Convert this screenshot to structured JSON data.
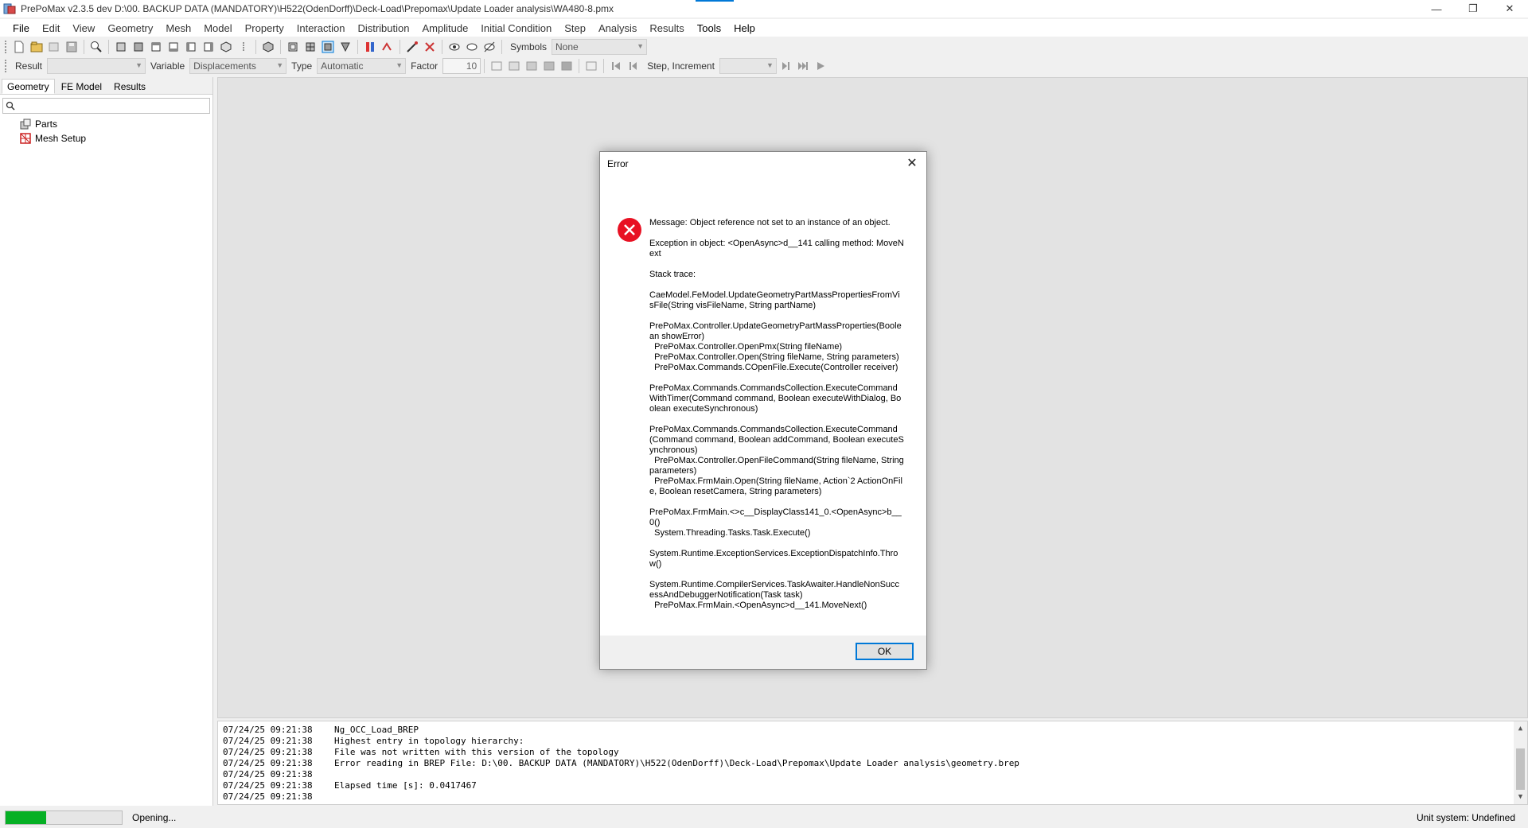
{
  "window": {
    "title": "PrePoMax v2.3.5 dev   D:\\00. BACKUP DATA (MANDATORY)\\H522(OdenDorff)\\Deck-Load\\Prepomax\\Update Loader analysis\\WA480-8.pmx"
  },
  "menu": [
    "File",
    "Edit",
    "View",
    "Geometry",
    "Mesh",
    "Model",
    "Property",
    "Interaction",
    "Distribution",
    "Amplitude",
    "Initial Condition",
    "Step",
    "Analysis",
    "Results",
    "Tools",
    "Help"
  ],
  "toolbar1": {
    "symbols_label": "Symbols",
    "symbols_value": "None"
  },
  "toolbar2": {
    "result_label": "Result",
    "result_value": "",
    "variable_label": "Variable",
    "variable_value": "Displacements",
    "type_label": "Type",
    "type_value": "Automatic",
    "factor_label": "Factor",
    "factor_value": "10",
    "step_label": "Step, Increment",
    "step_value": ""
  },
  "left_panel": {
    "tabs": [
      "Geometry",
      "FE Model",
      "Results"
    ],
    "tree": [
      "Parts",
      "Mesh Setup"
    ]
  },
  "log": [
    {
      "time": "07/24/25 09:21:38",
      "text": "Ng_OCC_Load_BREP"
    },
    {
      "time": "07/24/25 09:21:38",
      "text": "Highest entry in topology hierarchy:"
    },
    {
      "time": "07/24/25 09:21:38",
      "text": "File was not written with this version of the topology"
    },
    {
      "time": "07/24/25 09:21:38",
      "text": "Error reading in BREP File: D:\\00. BACKUP DATA (MANDATORY)\\H522(OdenDorff)\\Deck-Load\\Prepomax\\Update Loader analysis\\geometry.brep"
    },
    {
      "time": "07/24/25 09:21:38",
      "text": ""
    },
    {
      "time": "07/24/25 09:21:38",
      "text": "Elapsed time [s]: 0.0417467"
    },
    {
      "time": "07/24/25 09:21:38",
      "text": ""
    }
  ],
  "status": {
    "progress": 0.35,
    "text": "Opening...",
    "unit": "Unit system: Undefined"
  },
  "dialog": {
    "title": "Error",
    "paragraphs": [
      "Message: Object reference not set to an instance of an object.",
      "Exception in object: <OpenAsync>d__141 calling method: MoveNext",
      "Stack trace:",
      "CaeModel.FeModel.UpdateGeometryPartMassPropertiesFromVisFile(String visFileName, String partName)",
      "PrePoMax.Controller.UpdateGeometryPartMassProperties(Boolean showError)\n  PrePoMax.Controller.OpenPmx(String fileName)\n  PrePoMax.Controller.Open(String fileName, String parameters)\n  PrePoMax.Commands.COpenFile.Execute(Controller receiver)",
      "PrePoMax.Commands.CommandsCollection.ExecuteCommandWithTimer(Command command, Boolean executeWithDialog, Boolean executeSynchronous)",
      "PrePoMax.Commands.CommandsCollection.ExecuteCommand(Command command, Boolean addCommand, Boolean executeSynchronous)\n  PrePoMax.Controller.OpenFileCommand(String fileName, String parameters)\n  PrePoMax.FrmMain.Open(String fileName, Action`2 ActionOnFile, Boolean resetCamera, String parameters)",
      "PrePoMax.FrmMain.<>c__DisplayClass141_0.<OpenAsync>b__0()\n  System.Threading.Tasks.Task.Execute()",
      "System.Runtime.ExceptionServices.ExceptionDispatchInfo.Throw()",
      "System.Runtime.CompilerServices.TaskAwaiter.HandleNonSuccessAndDebuggerNotification(Task task)\n  PrePoMax.FrmMain.<OpenAsync>d__141.MoveNext()"
    ],
    "ok_label": "OK"
  }
}
